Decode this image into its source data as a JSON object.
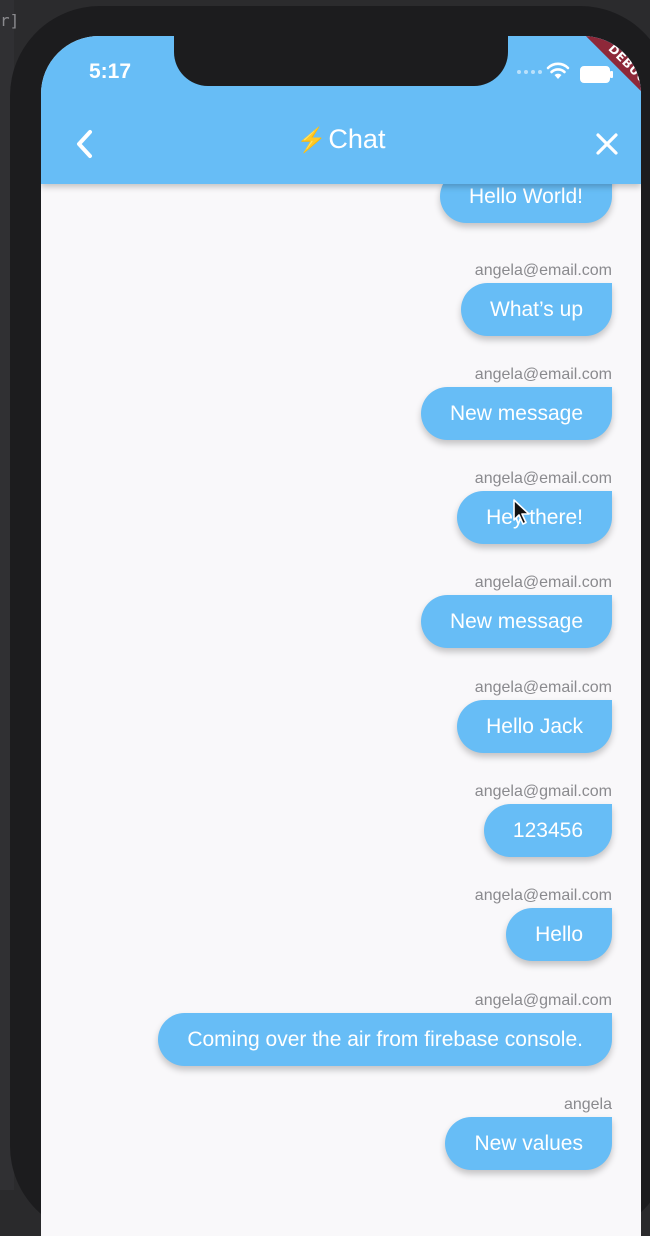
{
  "desktop": {
    "corner_text": "r]"
  },
  "status_bar": {
    "time": "5:17"
  },
  "debug_banner": "DEBUG",
  "app_bar": {
    "title_icon": "⚡",
    "title": "Chat",
    "back_icon": "chevron-left-icon",
    "close_icon": "close-icon"
  },
  "messages": [
    {
      "sender": "",
      "text": "Hello World!"
    },
    {
      "sender": "angela@email.com",
      "text": "What’s up"
    },
    {
      "sender": "angela@email.com",
      "text": "New message"
    },
    {
      "sender": "angela@email.com",
      "text": "Hey there!"
    },
    {
      "sender": "angela@email.com",
      "text": "New message"
    },
    {
      "sender": "angela@email.com",
      "text": "Hello Jack"
    },
    {
      "sender": "angela@gmail.com",
      "text": "123456"
    },
    {
      "sender": "angela@email.com",
      "text": "Hello"
    },
    {
      "sender": "angela@gmail.com",
      "text": "Coming over the air from firebase console."
    },
    {
      "sender": "angela",
      "text": "New values"
    }
  ],
  "colors": {
    "accent": "#67bdf6",
    "background": "#f9f8fa",
    "sender_text": "#8a8a8e",
    "debug_banner": "#8e2839"
  }
}
